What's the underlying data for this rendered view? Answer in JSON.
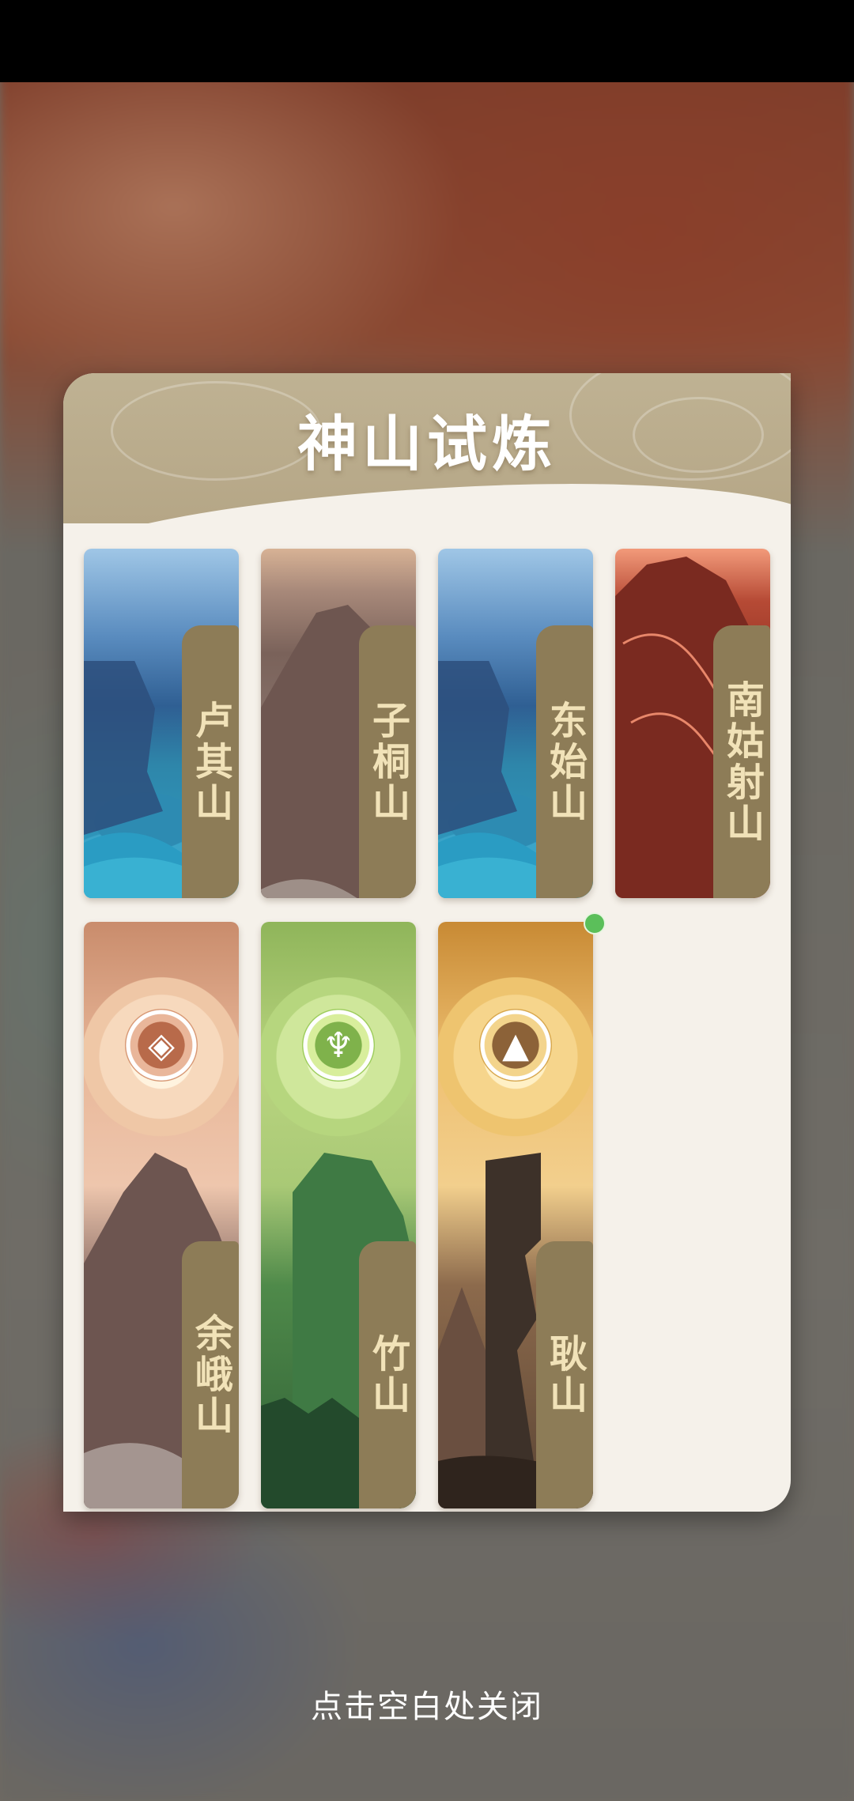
{
  "dialog": {
    "title": "神山试炼"
  },
  "cards": [
    {
      "label": "卢其山",
      "theme": "blue",
      "has_emblem": false
    },
    {
      "label": "子桐山",
      "theme": "brown",
      "has_emblem": false
    },
    {
      "label": "东始山",
      "theme": "blue",
      "has_emblem": false
    },
    {
      "label": "南姑射山",
      "theme": "red",
      "has_emblem": false
    },
    {
      "label": "余峨山",
      "theme": "peach",
      "has_emblem": true,
      "emblem_icon": "diamond-rune-icon"
    },
    {
      "label": "竹山",
      "theme": "green",
      "has_emblem": true,
      "emblem_icon": "trident-leaf-icon"
    },
    {
      "label": "耿山",
      "theme": "gold",
      "has_emblem": true,
      "emblem_icon": "triangle-rune-icon",
      "badge": "new-dot"
    }
  ],
  "footer": {
    "close_hint": "点击空白处关闭"
  },
  "colors": {
    "panel_bg": "#f5f1ea",
    "header_bg": "#b8aa8a",
    "label_bg": "#8d7c57",
    "label_text": "#f1e2b8",
    "badge_green": "#5bbf5a"
  }
}
